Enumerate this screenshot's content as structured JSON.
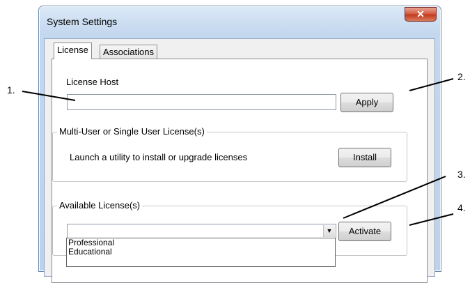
{
  "window": {
    "title": "System Settings",
    "close_glyph": "✕"
  },
  "tabs": [
    {
      "label": "License"
    },
    {
      "label": "Associations"
    }
  ],
  "license_host": {
    "label": "License Host",
    "value": "",
    "apply_label": "Apply"
  },
  "multi_user_group": {
    "label": "Multi-User or Single User License(s)",
    "description": "Launch a utility to install or upgrade licenses",
    "install_label": "Install"
  },
  "available_group": {
    "label": "Available License(s)",
    "selected": "",
    "activate_label": "Activate",
    "options": [
      "Professional",
      "Educational"
    ]
  },
  "callouts": [
    "1.",
    "2.",
    "3.",
    "4."
  ]
}
